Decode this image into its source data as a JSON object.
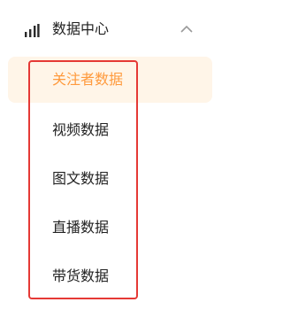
{
  "menu": {
    "title": "数据中心",
    "icon": "bar-chart-icon",
    "expanded": true,
    "collapse_icon": "chevron-up-icon",
    "items": [
      {
        "label": "关注者数据",
        "active": true
      },
      {
        "label": "视频数据",
        "active": false
      },
      {
        "label": "图文数据",
        "active": false
      },
      {
        "label": "直播数据",
        "active": false
      },
      {
        "label": "带货数据",
        "active": false
      }
    ]
  },
  "colors": {
    "active_text": "#ff9a3d",
    "active_background": "#fff5e8",
    "annotation_box": "#e53935"
  }
}
